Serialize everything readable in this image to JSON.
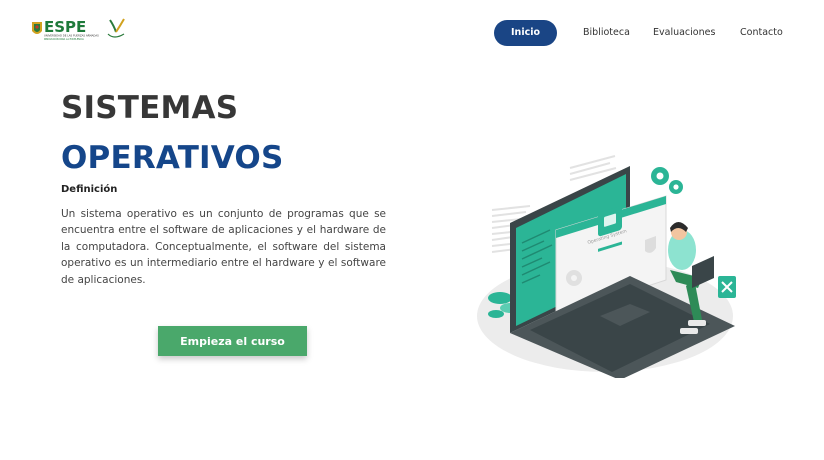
{
  "brand": {
    "logo_text": "ESPE",
    "logo_tagline": "UNIVERSIDAD DE LAS FUERZAS ARMADAS",
    "logo_motto": "INNOVACIÓN PARA LA EXCELENCIA"
  },
  "nav": {
    "items": [
      {
        "label": "Inicio",
        "active": true
      },
      {
        "label": "Biblioteca",
        "active": false
      },
      {
        "label": "Evaluaciones",
        "active": false
      },
      {
        "label": "Contacto",
        "active": false
      }
    ]
  },
  "hero": {
    "title_line1": "SISTEMAS",
    "title_line2": "OPERATIVOS",
    "subheading": "Definición",
    "description": "Un sistema operativo es un conjunto de programas que se encuentra entre el software de aplicaciones y el hardware de la computadora. Conceptualmente, el software del sistema operativo es un intermediario entre el hardware y el software de aplicaciones.",
    "cta_label": "Empieza el curso"
  },
  "illustration": {
    "window_title": "Operating System",
    "icons": [
      "gear-icon",
      "shield-icon",
      "tools-icon"
    ]
  },
  "colors": {
    "primary": "#1a4585",
    "title_dark": "#373737",
    "title_blue": "#15468a",
    "cta": "#4aa86b",
    "accent_teal": "#2bb596"
  }
}
